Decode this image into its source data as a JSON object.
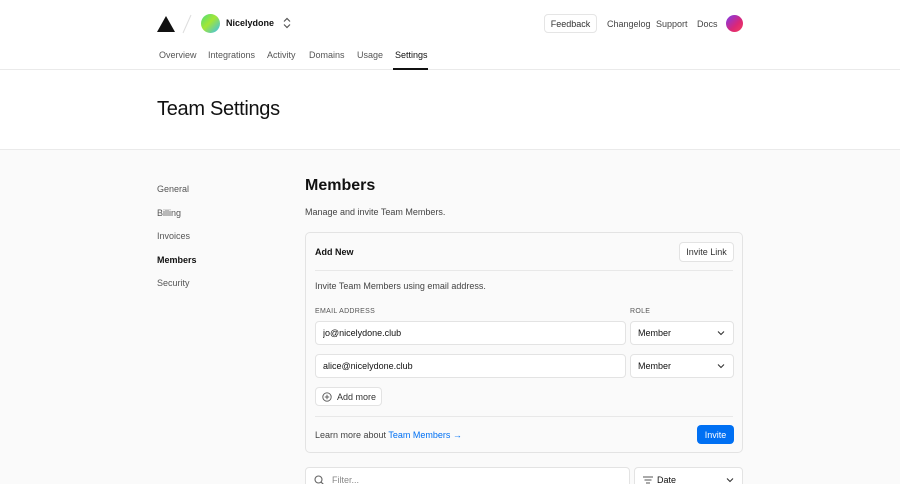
{
  "header": {
    "team_name": "Nicelydone",
    "feedback_label": "Feedback",
    "links": {
      "changelog": "Changelog",
      "support": "Support",
      "docs": "Docs"
    }
  },
  "tabs": [
    "Overview",
    "Integrations",
    "Activity",
    "Domains",
    "Usage",
    "Settings"
  ],
  "active_tab": "Settings",
  "page_title": "Team Settings",
  "sidebar": {
    "items": [
      "General",
      "Billing",
      "Invoices",
      "Members",
      "Security"
    ],
    "active": "Members"
  },
  "members": {
    "title": "Members",
    "description": "Manage and invite Team Members.",
    "add_new": {
      "title": "Add New",
      "invite_link_label": "Invite Link",
      "description": "Invite Team Members using email address.",
      "email_label": "EMAIL ADDRESS",
      "role_label": "ROLE",
      "rows": [
        {
          "email": "jo@nicelydone.club",
          "role": "Member"
        },
        {
          "email": "alice@nicelydone.club",
          "role": "Member"
        }
      ],
      "add_more_label": "Add more",
      "learn_prefix": "Learn more about",
      "learn_link": "Team Members →",
      "invite_label": "Invite"
    },
    "filter": {
      "placeholder": "Filter...",
      "sort_label": "Date"
    }
  },
  "colors": {
    "accent": "#0070f3",
    "text": "#111111",
    "border": "#e3e3e3",
    "background": "#fafafa"
  },
  "icons": [
    "logo-triangle-icon",
    "chevron-up-down-icon",
    "chevron-down-icon",
    "plus-circle-icon",
    "search-icon",
    "sort-lines-icon"
  ]
}
